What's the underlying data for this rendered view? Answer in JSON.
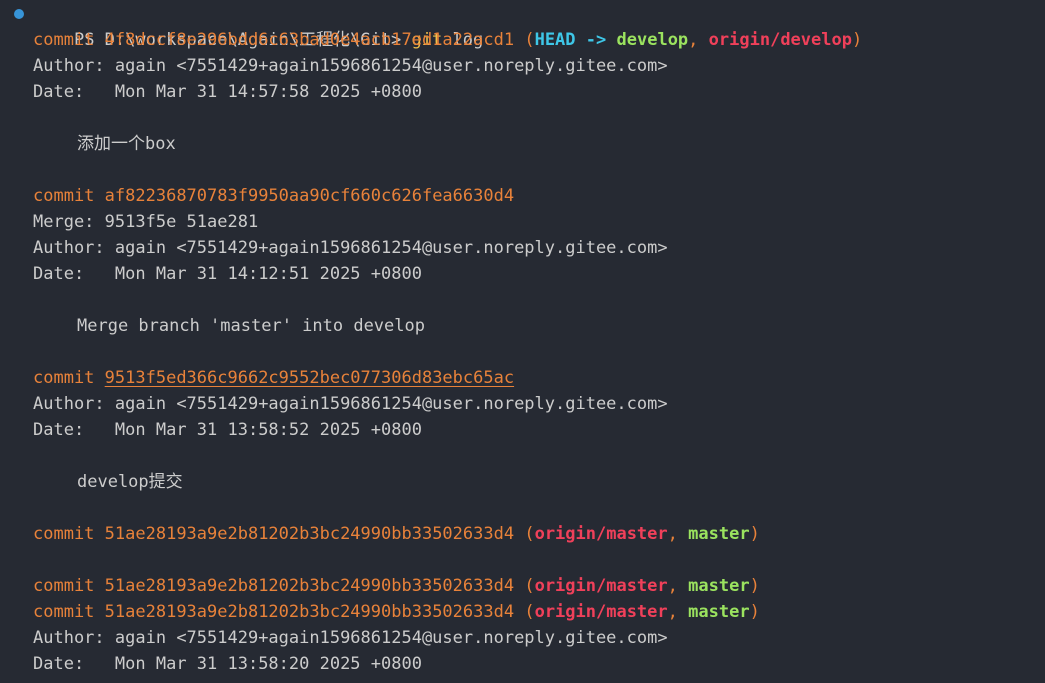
{
  "terminal": {
    "prompt_indicator_color": "#3794d8",
    "prompt": "PS D:\\workspace\\Again\\工程化\\Git>",
    "command": "git",
    "command_args": "log",
    "colors": {
      "commit": "#e8823a",
      "head": "#3ec7e8",
      "local_branch": "#9be35f",
      "remote_branch": "#f0405a",
      "text": "#cccccc",
      "background": "#262a33"
    },
    "labels": {
      "commit": "commit",
      "author": "Author:",
      "date": "Date:",
      "merge": "Merge:",
      "arrow": "->",
      "comma": ",",
      "open_paren": "(",
      "close_paren": ")"
    },
    "entries": [
      {
        "hash": "4f8dccf8e296bdd6c63bad0e4acb17ed1a22acd1",
        "head": "HEAD",
        "branch": "develop",
        "remote": "origin/develop",
        "author": "again <7551429+again1596861254@user.noreply.gitee.com>",
        "date": "Mon Mar 31 14:57:58 2025 +0800",
        "message": "添加一个box"
      },
      {
        "hash": "af82236870783f9950aa90cf660c626fea6630d4",
        "merge": "9513f5e 51ae281",
        "author": "again <7551429+again1596861254@user.noreply.gitee.com>",
        "date": "Mon Mar 31 14:12:51 2025 +0800",
        "message": "Merge branch 'master' into develop"
      },
      {
        "hash": "9513f5ed366c9662c9552bec077306d83ebc65ac",
        "author": "again <7551429+again1596861254@user.noreply.gitee.com>",
        "date": "Mon Mar 31 13:58:52 2025 +0800",
        "message": "develop提交"
      },
      {
        "hash": "51ae28193a9e2b81202b3bc24990bb33502633d4",
        "remote": "origin/master",
        "branch": "master"
      },
      {
        "hash": "51ae28193a9e2b81202b3bc24990bb33502633d4",
        "remote": "origin/master",
        "branch": "master"
      },
      {
        "hash": "51ae28193a9e2b81202b3bc24990bb33502633d4",
        "remote": "origin/master",
        "branch": "master",
        "author": "again <7551429+again1596861254@user.noreply.gitee.com>",
        "date": "Mon Mar 31 13:58:20 2025 +0800"
      }
    ]
  }
}
